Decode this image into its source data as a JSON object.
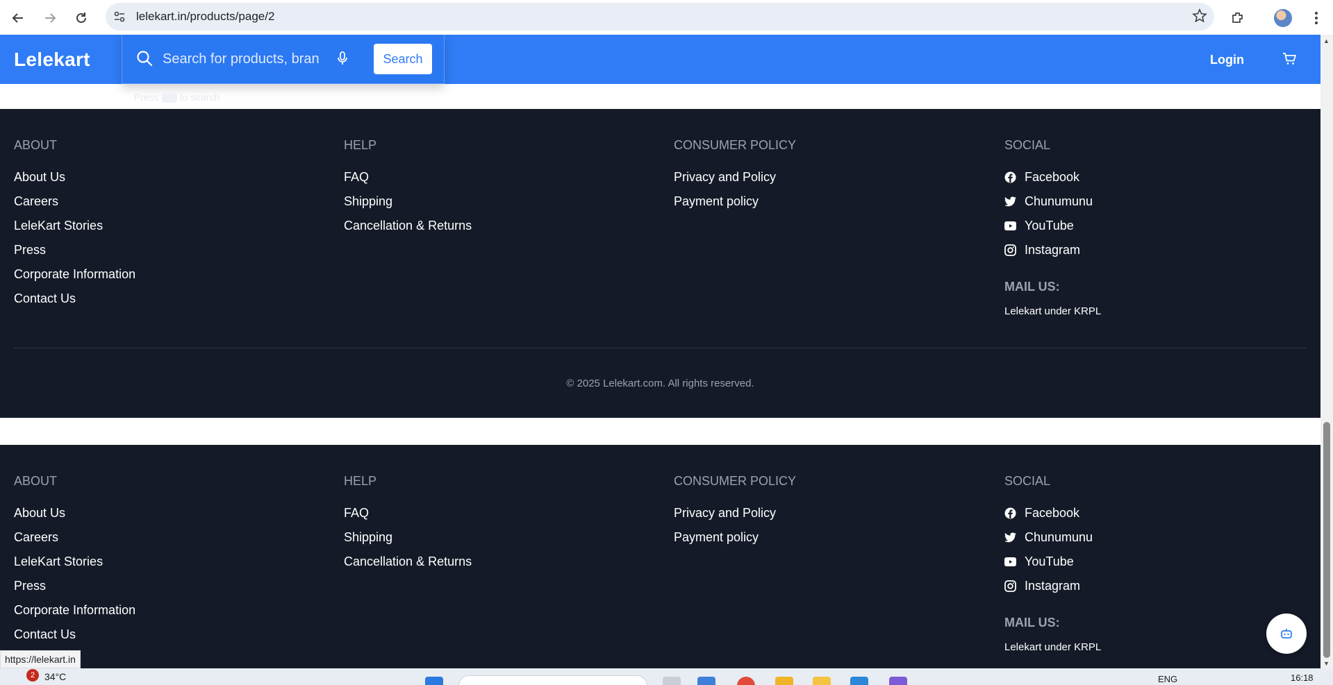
{
  "browser": {
    "url": "lelekart.in/products/page/2",
    "status_url": "https://lelekart.in"
  },
  "header": {
    "logo": "Lelekart",
    "search_placeholder": "Search for products, brands",
    "search_button": "Search",
    "hint_before": "Press",
    "hint_after": "to search",
    "login": "Login"
  },
  "footer": {
    "about": {
      "heading": "ABOUT",
      "links": [
        "About Us",
        "Careers",
        "LeleKart Stories",
        "Press",
        "Corporate Information",
        "Contact Us"
      ]
    },
    "help": {
      "heading": "HELP",
      "links": [
        "FAQ",
        "Shipping",
        "Cancellation & Returns"
      ]
    },
    "policy": {
      "heading": "CONSUMER POLICY",
      "links": [
        "Privacy and Policy",
        "Payment policy"
      ]
    },
    "social": {
      "heading": "SOCIAL",
      "links": [
        {
          "label": "Facebook",
          "icon": "facebook-icon"
        },
        {
          "label": "Chunumunu",
          "icon": "twitter-icon"
        },
        {
          "label": "YouTube",
          "icon": "youtube-icon"
        },
        {
          "label": "Instagram",
          "icon": "instagram-icon"
        }
      ]
    },
    "mail_heading": "MAIL US:",
    "mail_value": "Lelekart under KRPL",
    "copyright": "© 2025 Lelekart.com. All rights reserved."
  },
  "taskbar": {
    "weather": "34°C",
    "notification_count": "2",
    "language": "ENG",
    "time": "16:18"
  },
  "colors": {
    "brand_blue": "#2f7cf6",
    "footer_bg": "#141a28",
    "muted_text": "#9aa3b2"
  }
}
